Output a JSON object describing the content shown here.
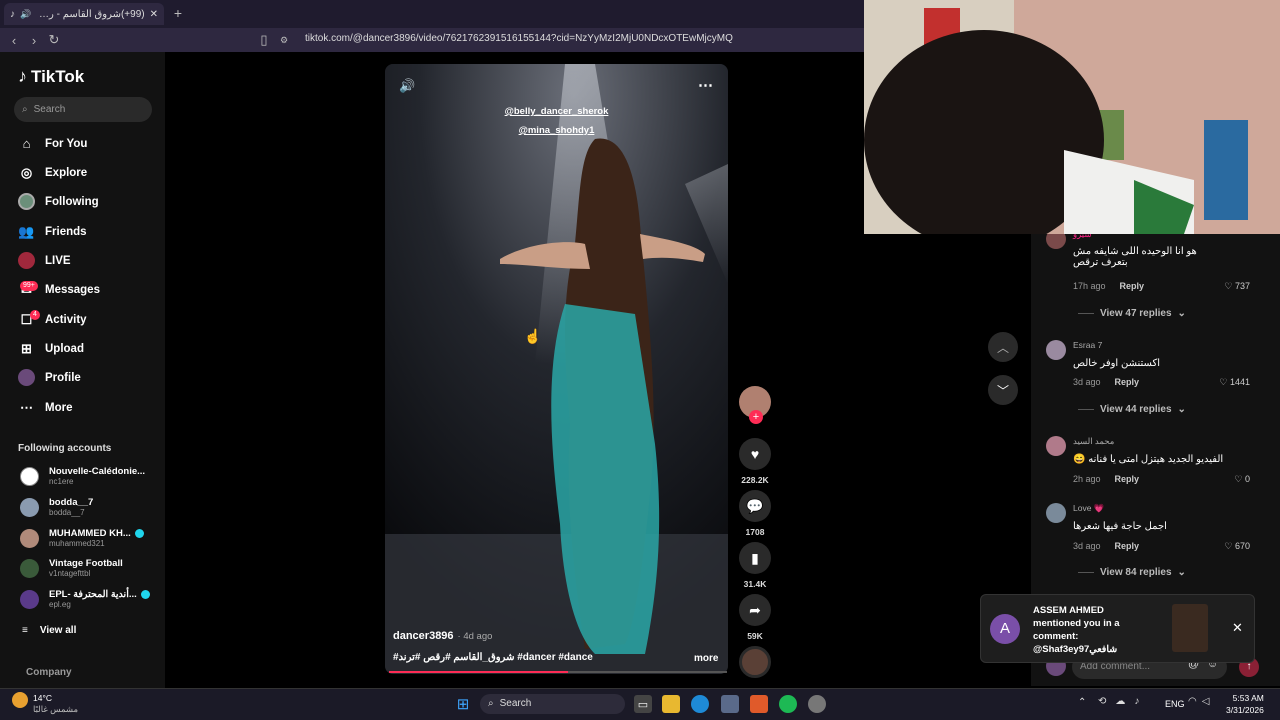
{
  "browser": {
    "tab_title": "(99+)شروق القاسم - رقص ترند",
    "url": "tiktok.com/@dancer3896/video/7621762391516155144?cid=NzYyMzI2MjU0NDcxOTEwMjcyMQ"
  },
  "sidebar": {
    "logo": "TikTok",
    "search_placeholder": "Search",
    "nav": [
      {
        "label": "For You",
        "icon": "home-icon"
      },
      {
        "label": "Explore",
        "icon": "compass-icon"
      },
      {
        "label": "Following",
        "icon": "following-avatar-icon"
      },
      {
        "label": "Friends",
        "icon": "friends-icon"
      },
      {
        "label": "LIVE",
        "icon": "live-icon"
      },
      {
        "label": "Messages",
        "icon": "messages-icon",
        "badge": "99+"
      },
      {
        "label": "Activity",
        "icon": "activity-icon",
        "badge": "4"
      },
      {
        "label": "Upload",
        "icon": "upload-icon"
      },
      {
        "label": "Profile",
        "icon": "profile-avatar-icon"
      },
      {
        "label": "More",
        "icon": "more-icon"
      }
    ],
    "following_title": "Following accounts",
    "accounts": [
      {
        "name": "Nouvelle-Calédonie...",
        "handle": "nc1ere",
        "verified": false,
        "color": "#ffffff"
      },
      {
        "name": "bodda__7",
        "handle": "bodda__7",
        "verified": false,
        "color": "#8a9bb0"
      },
      {
        "name": "MUHAMMED KH...",
        "handle": "muhammed321",
        "verified": true,
        "color": "#b08a7a"
      },
      {
        "name": "Vintage Football",
        "handle": "v1ntagefttbl",
        "verified": false,
        "color": "#3a5a3a"
      },
      {
        "name": "EPL- أندية المحترفة...",
        "handle": "epl.eg",
        "verified": true,
        "color": "#5a3a8a"
      }
    ],
    "view_all": "View all",
    "company": "Company"
  },
  "video": {
    "overlay_tag_1": "@belly_dancer_sherok",
    "overlay_tag_2": "@mina_shohdy1",
    "author": "dancer3896",
    "age": "· 4d ago",
    "caption": "#شروق_القاسم #رقص #ترند #dancer #dance",
    "more": "more",
    "progress": 0.53
  },
  "actions": {
    "likes": "228.2K",
    "comments": "1708",
    "saves": "31.4K",
    "shares": "59K"
  },
  "comments": [
    {
      "user": "شيرو",
      "text": "هو انا الوحيده اللى شايفه مش بتعرف ترقص",
      "time": "17h ago",
      "reply": "Reply",
      "likes": "737",
      "view_replies": "View 47 replies",
      "color": "#7a4a4a"
    },
    {
      "user": "Esraa 7",
      "text": "اكستنشن اوفر خالص",
      "time": "3d ago",
      "reply": "Reply",
      "likes": "1441",
      "view_replies": "View 44 replies",
      "color": "#9a8aa0"
    },
    {
      "user": "محمد السيد",
      "text": "الفيديو الجديد هيتزل امتى يا فنانه 😄",
      "time": "2h ago",
      "reply": "Reply",
      "likes": "0",
      "view_replies": "",
      "color": "#b07a8a"
    },
    {
      "user": "Love 💗",
      "text": "اجمل حاجة فيها شعرها",
      "time": "3d ago",
      "reply": "Reply",
      "likes": "670",
      "view_replies": "View 84 replies",
      "color": "#7a8a9a"
    }
  ],
  "comment_input_placeholder": "Add comment...",
  "toast": {
    "avatar_letter": "A",
    "title": "ASSEM AHMED",
    "line1": "mentioned you in a",
    "line2": "comment:",
    "line3": "@Shaf3ey97شافعي"
  },
  "taskbar": {
    "weather_temp": "14°C",
    "weather_desc": "مشمس غالبًا",
    "search": "Search",
    "lang": "ENG",
    "time": "5:53 AM",
    "date": "3/31/2026"
  }
}
